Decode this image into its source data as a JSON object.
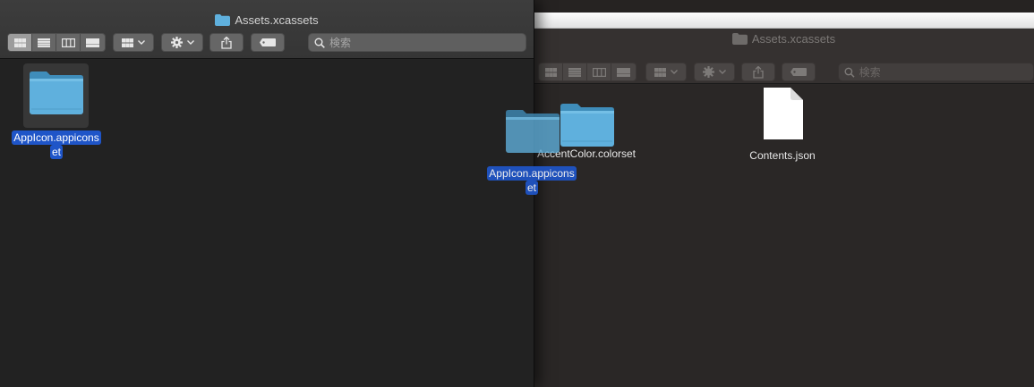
{
  "back_window": {
    "title": "Assets.xcassets",
    "search_placeholder": "検索",
    "items": [
      {
        "label": "AccentColor.colorset"
      },
      {
        "label": "Contents.json"
      }
    ]
  },
  "front_window": {
    "title": "Assets.xcassets",
    "search_placeholder": "検索",
    "items": [
      {
        "label_line1": "AppIcon.appicons",
        "label_line2": "et"
      }
    ]
  },
  "drag_ghost": {
    "label_line1": "AppIcon.appicons",
    "label_line2": "et"
  },
  "colors": {
    "folder": "#5fb0dd",
    "selection": "#1f55c8"
  },
  "icons": {
    "view_modes": [
      "icon-view-icon",
      "list-view-icon",
      "column-view-icon",
      "gallery-view-icon"
    ],
    "toolbar": [
      "group-by-icon",
      "gear-icon",
      "share-icon",
      "tag-icon",
      "search-icon"
    ]
  }
}
